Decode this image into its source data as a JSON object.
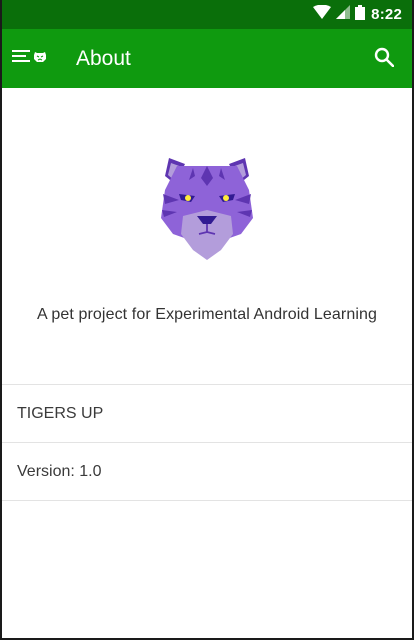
{
  "status_bar": {
    "time": "8:22",
    "icons": [
      "wifi-icon",
      "signal-icon",
      "battery-icon"
    ]
  },
  "app_bar": {
    "title": "About",
    "nav_icon": "menu-tiger-icon",
    "action_icon": "search-icon",
    "background_color": "#0f9a0f",
    "status_color": "#0a6f0a"
  },
  "about": {
    "logo": "tiger-logo",
    "tagline": "A pet project for Experimental Android Learning",
    "items": [
      {
        "label": "TIGERS UP"
      },
      {
        "label": "Version: 1.0"
      }
    ]
  },
  "colors": {
    "tiger_primary": "#8e63d8",
    "tiger_dark": "#5e35b1",
    "tiger_light": "#b39ddb"
  }
}
